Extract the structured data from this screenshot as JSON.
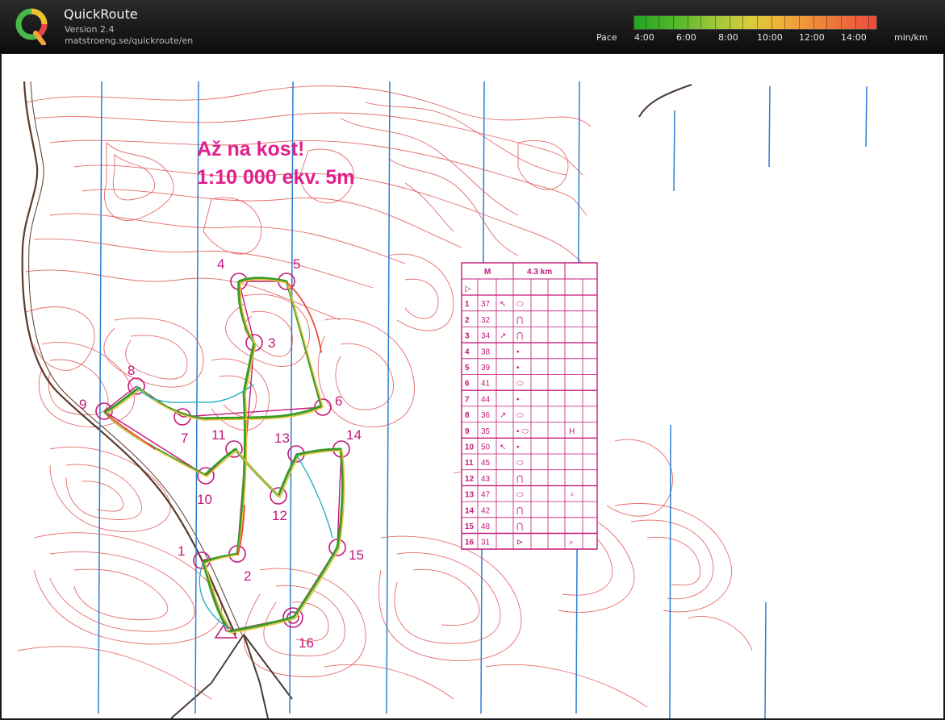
{
  "header": {
    "app_title": "QuickRoute",
    "version": "Version 2.4",
    "url": "matstroeng.se/quickroute/en",
    "pace_label": "Pace",
    "pace_ticks": [
      "4:00",
      "6:00",
      "8:00",
      "10:00",
      "12:00",
      "14:00"
    ],
    "pace_unit": "min/km",
    "pace_gradient_colors": [
      "#22a421",
      "#a6c93a",
      "#d8cc3c",
      "#f0b33a",
      "#f08a3a",
      "#ed4b3c"
    ]
  },
  "map": {
    "title_line1": "Až na kost!",
    "title_line2": "1:10 000    ekv. 5m",
    "contour_color": "#e0524f",
    "north_line_color": "#2a7fd4",
    "course_color": "#c4187a",
    "control_numbers": [
      "1",
      "2",
      "3",
      "4",
      "5",
      "6",
      "7",
      "8",
      "9",
      "10",
      "11",
      "12",
      "13",
      "14",
      "15",
      "16"
    ],
    "description_sheet": {
      "header_left": "M",
      "header_right": "4.3 km",
      "start_symbol": "▷",
      "rows": [
        {
          "num": "1",
          "code": "37",
          "dir": "↖",
          "sym": "⬭",
          "extra": ""
        },
        {
          "num": "2",
          "code": "32",
          "dir": "",
          "sym": "⋂",
          "extra": ""
        },
        {
          "num": "3",
          "code": "34",
          "dir": "↗",
          "sym": "⋂",
          "extra": ""
        },
        {
          "num": "4",
          "code": "38",
          "dir": "",
          "sym": "•",
          "extra": ""
        },
        {
          "num": "5",
          "code": "39",
          "dir": "",
          "sym": "•",
          "extra": ""
        },
        {
          "num": "6",
          "code": "41",
          "dir": "",
          "sym": "⬭",
          "extra": ""
        },
        {
          "num": "7",
          "code": "44",
          "dir": "",
          "sym": "•",
          "extra": ""
        },
        {
          "num": "8",
          "code": "36",
          "dir": "↗",
          "sym": "⬭",
          "extra": ""
        },
        {
          "num": "9",
          "code": "35",
          "dir": "",
          "sym": "• ⬭",
          "extra": "H"
        },
        {
          "num": "10",
          "code": "50",
          "dir": "↖",
          "sym": "•",
          "extra": ""
        },
        {
          "num": "11",
          "code": "45",
          "dir": "",
          "sym": "⬭",
          "extra": ""
        },
        {
          "num": "12",
          "code": "43",
          "dir": "",
          "sym": "⋂",
          "extra": ""
        },
        {
          "num": "13",
          "code": "47",
          "dir": "",
          "sym": "⬭",
          "extra": "♀"
        },
        {
          "num": "14",
          "code": "42",
          "dir": "",
          "sym": "⋂",
          "extra": ""
        },
        {
          "num": "15",
          "code": "48",
          "dir": "",
          "sym": "⋂",
          "extra": ""
        },
        {
          "num": "16",
          "code": "31",
          "dir": "",
          "sym": "⊳",
          "extra": "⌕"
        }
      ]
    }
  }
}
